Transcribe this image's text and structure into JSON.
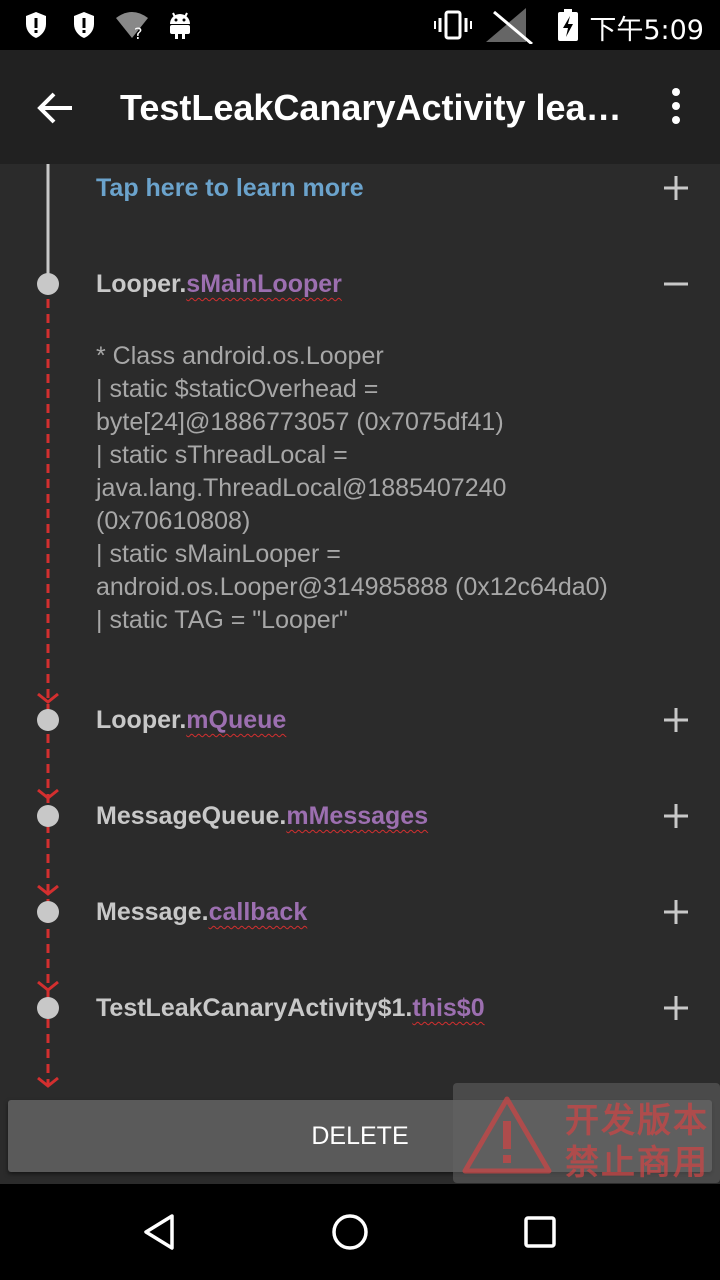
{
  "status_bar": {
    "time": "下午5:09",
    "icons": [
      "shield-alert-icon",
      "shield-alert-icon",
      "wifi-unknown-icon",
      "android-icon",
      "vibrate-icon",
      "no-signal-icon",
      "battery-charging-icon"
    ]
  },
  "app_bar": {
    "title": "TestLeakCanaryActivity leaked",
    "icons": [
      "back-arrow-icon",
      "more-vert-icon"
    ]
  },
  "trace": {
    "learn_more": "Tap here to learn more",
    "rows": [
      {
        "class_name": "Looper.",
        "field": "sMainLooper",
        "expanded": true
      },
      {
        "class_name": "Looper.",
        "field": "mQueue",
        "expanded": false
      },
      {
        "class_name": "MessageQueue.",
        "field": "mMessages",
        "expanded": false
      },
      {
        "class_name": "Message.",
        "field": "callback",
        "expanded": false
      },
      {
        "class_name": "TestLeakCanaryActivity$1.",
        "field": "this$0",
        "expanded": false
      }
    ],
    "details": "* Class android.os.Looper\n| static $staticOverhead =\nbyte[24]@1886773057 (0x7075df41)\n| static sThreadLocal =\njava.lang.ThreadLocal@1885407240\n(0x70610808)\n| static sMainLooper =\nandroid.os.Looper@314985888 (0x12c64da0)\n| static TAG = \"Looper\""
  },
  "delete_button": {
    "label": "DELETE"
  },
  "watermark": {
    "line1": "开发版本",
    "line2": "禁止商用"
  },
  "nav_bar": {
    "icons": [
      "back-triangle-icon",
      "home-circle-icon",
      "recents-square-icon"
    ]
  },
  "colors": {
    "app_bar": "#212121",
    "content_bg": "#2b2b2b",
    "field_purple": "#9c6fb0",
    "learn_more_blue": "#6ba3cc",
    "leak_red": "#d32f2f"
  }
}
